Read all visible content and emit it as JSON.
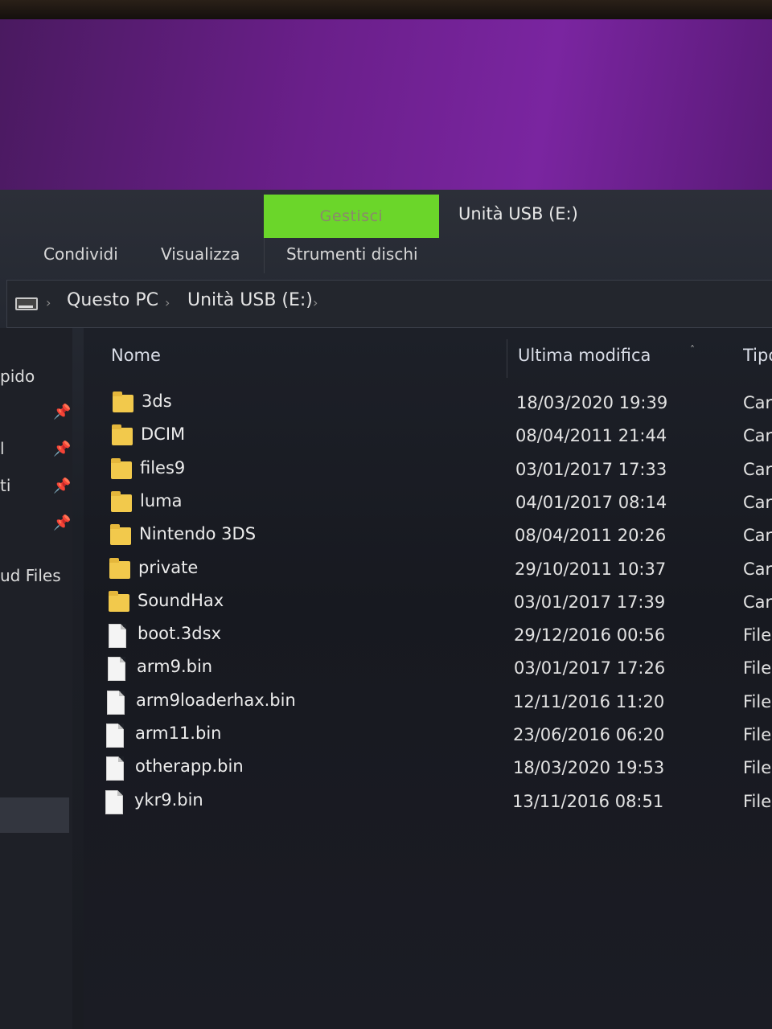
{
  "ribbon": {
    "manage_tab": "Gestisci",
    "window_title": "Unità USB (E:)",
    "tabs": [
      "Condividi",
      "Visualizza",
      "Strumenti dischi"
    ]
  },
  "address": {
    "crumbs": [
      "Questo PC",
      "Unità USB (E:)"
    ]
  },
  "nav": {
    "items": [
      "pido",
      "l",
      "ti",
      "",
      "ud Files"
    ]
  },
  "columns": {
    "name": "Nome",
    "modified": "Ultima modifica",
    "type": "Tipo"
  },
  "files": [
    {
      "name": "3ds",
      "date": "18/03/2020 19:39",
      "type": "Cartella",
      "kind": "folder"
    },
    {
      "name": "DCIM",
      "date": "08/04/2011 21:44",
      "type": "Cartella",
      "kind": "folder"
    },
    {
      "name": "files9",
      "date": "03/01/2017 17:33",
      "type": "Cartella",
      "kind": "folder"
    },
    {
      "name": "luma",
      "date": "04/01/2017 08:14",
      "type": "Cartella",
      "kind": "folder"
    },
    {
      "name": "Nintendo 3DS",
      "date": "08/04/2011 20:26",
      "type": "Cartella",
      "kind": "folder"
    },
    {
      "name": "private",
      "date": "29/10/2011 10:37",
      "type": "Cartella",
      "kind": "folder"
    },
    {
      "name": "SoundHax",
      "date": "03/01/2017 17:39",
      "type": "Cartella",
      "kind": "folder"
    },
    {
      "name": "boot.3dsx",
      "date": "29/12/2016 00:56",
      "type": "File",
      "kind": "file"
    },
    {
      "name": "arm9.bin",
      "date": "03/01/2017 17:26",
      "type": "File",
      "kind": "file"
    },
    {
      "name": "arm9loaderhax.bin",
      "date": "12/11/2016 11:20",
      "type": "File",
      "kind": "file"
    },
    {
      "name": "arm11.bin",
      "date": "23/06/2016 06:20",
      "type": "File",
      "kind": "file"
    },
    {
      "name": "otherapp.bin",
      "date": "18/03/2020 19:53",
      "type": "File",
      "kind": "file"
    },
    {
      "name": "ykr9.bin",
      "date": "13/11/2016 08:51",
      "type": "File",
      "kind": "file"
    }
  ],
  "colors": {
    "manage_tab": "#6bd62a",
    "folder": "#f2c94c",
    "desktop": "#6a1f8a"
  }
}
